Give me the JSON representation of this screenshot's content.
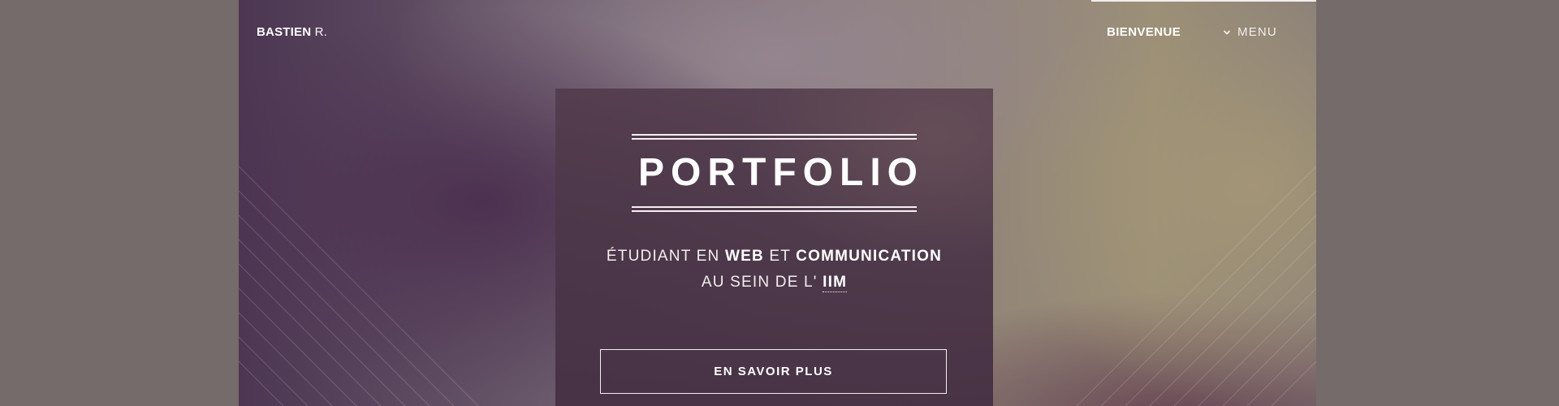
{
  "header": {
    "brand_bold": "BASTIEN",
    "brand_light": "R.",
    "nav_link": "BIENVENUE",
    "menu_label": "MENU"
  },
  "hero": {
    "title": "PORTFOLIO",
    "subtitle": {
      "line1_part1": "ÉTUDIANT EN ",
      "line1_bold1": "WEB",
      "line1_part2": " ET ",
      "line1_bold2": "COMMUNICATION",
      "line2_part1": "AU SEIN DE L' ",
      "line2_link": "IIM"
    },
    "cta_label": "EN SAVOIR PLUS"
  },
  "icons": {
    "menu": "chevron-down-icon"
  },
  "colors": {
    "page_background": "#756b6a",
    "card_background": "#4b3648",
    "text": "#ffffff"
  }
}
